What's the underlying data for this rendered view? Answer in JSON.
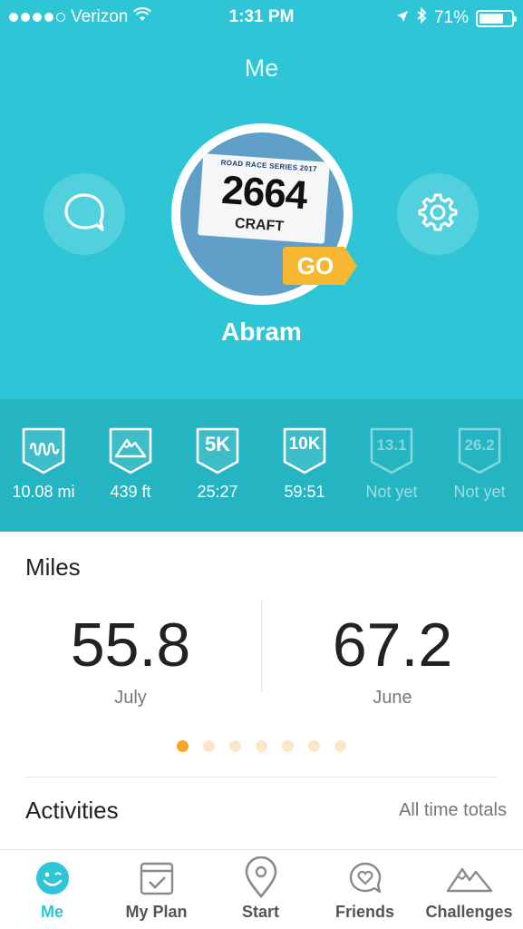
{
  "status_bar": {
    "carrier": "Verizon",
    "time": "1:31 PM",
    "battery": "71%",
    "battery_level": 0.71
  },
  "header": {
    "title": "Me",
    "chat_icon": "chat-bubble-icon",
    "settings_icon": "gear-icon"
  },
  "profile": {
    "name": "Abram",
    "bib_series": "ROAD RACE SERIES 2017",
    "bib_number": "2664",
    "bib_brand": "CRAFT",
    "go_badge": "GO"
  },
  "records": [
    {
      "badge": "",
      "icon": "distance-icon",
      "value": "10.08 mi",
      "achieved": true
    },
    {
      "badge": "",
      "icon": "elevation-icon",
      "value": "439 ft",
      "achieved": true
    },
    {
      "badge": "5K",
      "icon": "5k-badge-icon",
      "value": "25:27",
      "achieved": true
    },
    {
      "badge": "10K",
      "icon": "10k-badge-icon",
      "value": "59:51",
      "achieved": true
    },
    {
      "badge": "13.1",
      "icon": "half-marathon-badge-icon",
      "value": "Not yet",
      "achieved": false
    },
    {
      "badge": "26.2",
      "icon": "marathon-badge-icon",
      "value": "Not yet",
      "achieved": false
    }
  ],
  "miles": {
    "title": "Miles",
    "left": {
      "value": "55.8",
      "label": "July"
    },
    "right": {
      "value": "67.2",
      "label": "June"
    },
    "pages": 7,
    "active_page": 0
  },
  "activities": {
    "title": "Activities",
    "subtitle": "All time totals"
  },
  "tabs": [
    {
      "label": "Me",
      "icon": "smiley-icon",
      "active": true
    },
    {
      "label": "My Plan",
      "icon": "plan-checklist-icon",
      "active": false
    },
    {
      "label": "Start",
      "icon": "location-pin-icon",
      "active": false
    },
    {
      "label": "Friends",
      "icon": "friends-heart-icon",
      "active": false
    },
    {
      "label": "Challenges",
      "icon": "mountains-icon",
      "active": false
    }
  ],
  "colors": {
    "header_bg": "#2ec6d6",
    "records_bg": "#24b4c2",
    "accent_orange": "#f6a623",
    "go_badge": "#f7b731"
  }
}
